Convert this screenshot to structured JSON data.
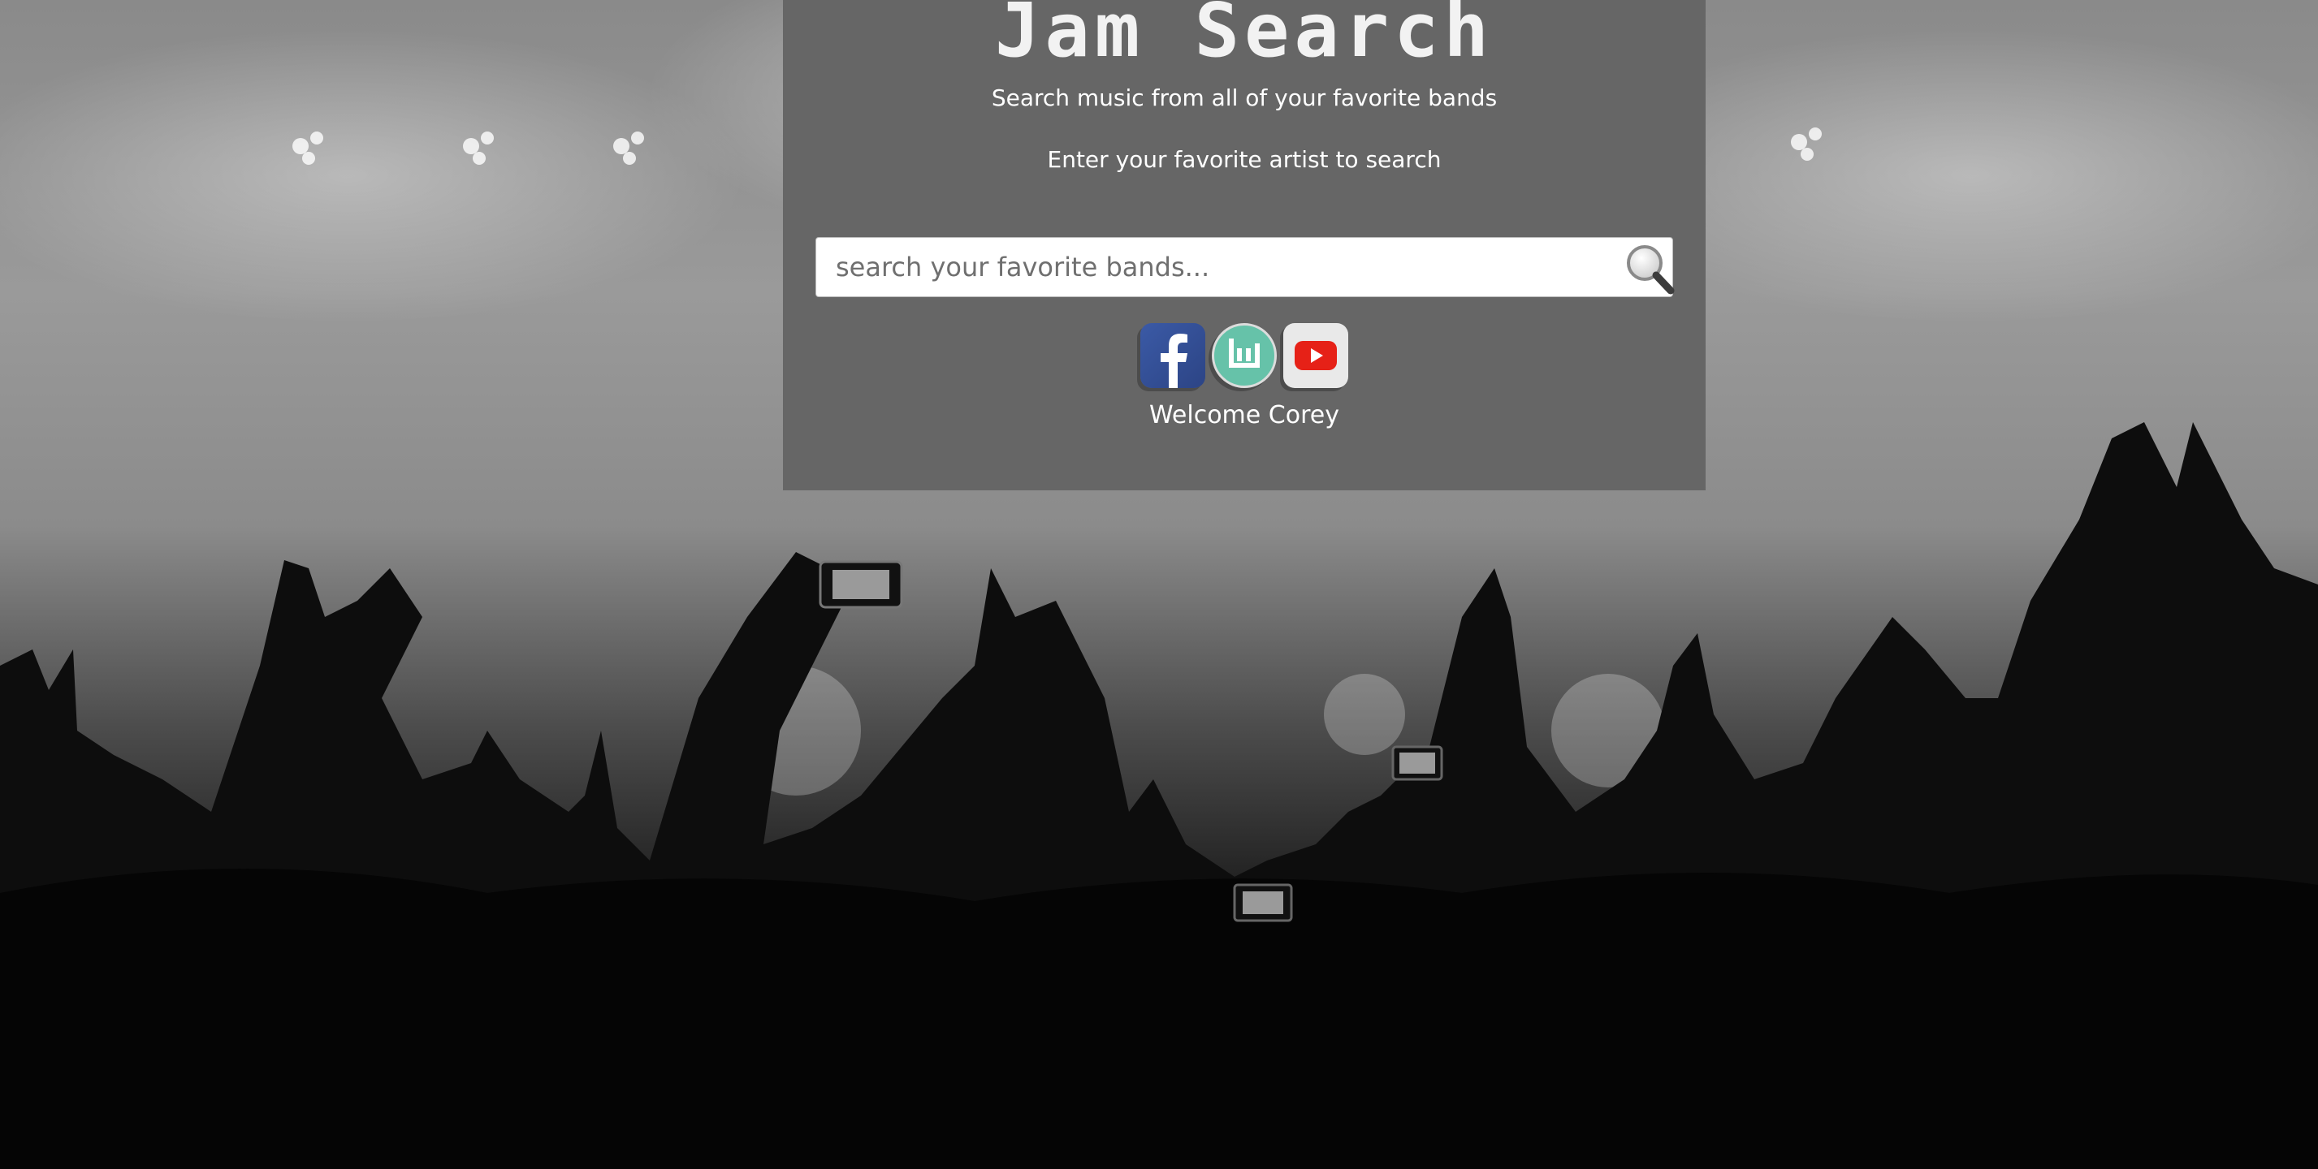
{
  "app": {
    "title": "Jam Search",
    "subtitle": "Search music from all of your favorite bands",
    "prompt": "Enter your favorite artist to search"
  },
  "search": {
    "placeholder": "search your favorite bands...",
    "value": "",
    "button_icon": "magnifier-icon"
  },
  "socials": [
    {
      "name": "Facebook",
      "icon": "facebook-icon",
      "color": "#3b5aa6"
    },
    {
      "name": "Bandsintown",
      "icon": "bandsintown-icon",
      "color": "#66c2a9"
    },
    {
      "name": "YouTube",
      "icon": "youtube-icon",
      "color": "#e62117"
    }
  ],
  "user": {
    "welcome": "Welcome Corey"
  },
  "colors": {
    "panel": "#666666",
    "text": "#ffffff"
  }
}
